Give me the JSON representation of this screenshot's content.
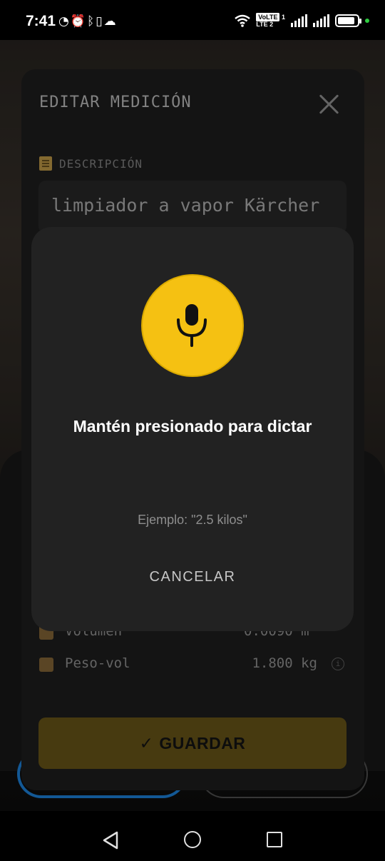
{
  "status_bar": {
    "time": "7:41",
    "left_icons": [
      "speed-icon",
      "alarm-icon",
      "bluetooth-icon",
      "vibrate-icon",
      "cloud-icon"
    ],
    "network_badge_top": "VoLTE",
    "network_badge_sim": "1",
    "network_badge_bottom": "LTE 2",
    "battery_level": 0.88
  },
  "edit_dialog": {
    "title": "EDITAR MEDICIÓN",
    "description_label": "DESCRIPCIÓN",
    "description_value": "limpiador a vapor Kärcher",
    "rows": [
      {
        "label": "Volumen",
        "value": "0.0090 m³"
      },
      {
        "label": "Peso-vol",
        "value": "1.800 kg"
      }
    ],
    "save_check": "✓",
    "save_label": "GUARDAR",
    "colors": {
      "save_bg": "#6e5a1a",
      "dialog_bg": "#1f1f1f"
    }
  },
  "voice_dialog": {
    "title": "Mantén presionado para dictar",
    "hint": "Ejemplo: \"2.5 kilos\"",
    "cancel_label": "CANCELAR",
    "colors": {
      "mic_bg": "#f5c112",
      "dialog_bg": "#222222"
    }
  }
}
